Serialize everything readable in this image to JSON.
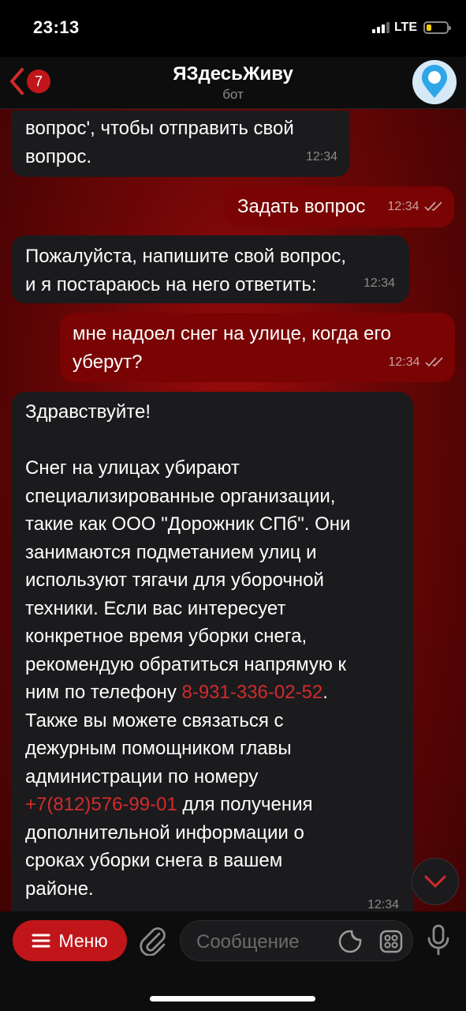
{
  "status_bar": {
    "time": "23:13",
    "network": "LTE"
  },
  "header": {
    "back_badge": "7",
    "title": "ЯЗдесьЖиву",
    "subtitle": "бот"
  },
  "messages": [
    {
      "dir": "in",
      "text": "вопрос', чтобы отправить свой\nвопрос.",
      "time": "12:34"
    },
    {
      "dir": "out",
      "text": "Задать вопрос",
      "time": "12:34"
    },
    {
      "dir": "in",
      "text": "Пожалуйста, напишите свой вопрос,\nи я постараюсь на него ответить:",
      "time": "12:34"
    },
    {
      "dir": "out",
      "text": "мне надоел снег на улице, когда его\nуберут?",
      "time": "12:34"
    },
    {
      "dir": "in",
      "greeting": "Здравствуйте!",
      "body_part1": "Снег на улицах убирают\nспециализированные организации,\nтакие как ООО \"Дорожник СПб\". Они\nзанимаются подметанием улиц и\nиспользуют тягачи для уборочной\nтехники. Если вас интересует\nконкретное время уборки снега,\nрекомендую обратиться напрямую к\nним по телефону ",
      "phone1": "8-931-336-02-52",
      "body_part2": ".\nТакже вы можете связаться с\nдежурным помощником главы\nадминистрации по номеру\n",
      "phone2": "+7(812)576-99-01",
      "body_part3": " для получения\nдополнительной информации о\nсроках уборки снега в вашем\nрайоне.",
      "time": "12:34"
    }
  ],
  "bottom_bar": {
    "menu_label": "Меню",
    "input_placeholder": "Сообщение"
  },
  "colors": {
    "accent": "#c0161a",
    "link": "#d42b2b",
    "incoming_bubble": "#1b1b1e",
    "outgoing_bubble": "#7a0303"
  },
  "icons": [
    "back-chevron-icon",
    "bot-avatar-icon",
    "double-check-icon",
    "scroll-down-icon",
    "menu-icon",
    "paperclip-icon",
    "sticker-icon",
    "apps-icon",
    "microphone-icon"
  ]
}
